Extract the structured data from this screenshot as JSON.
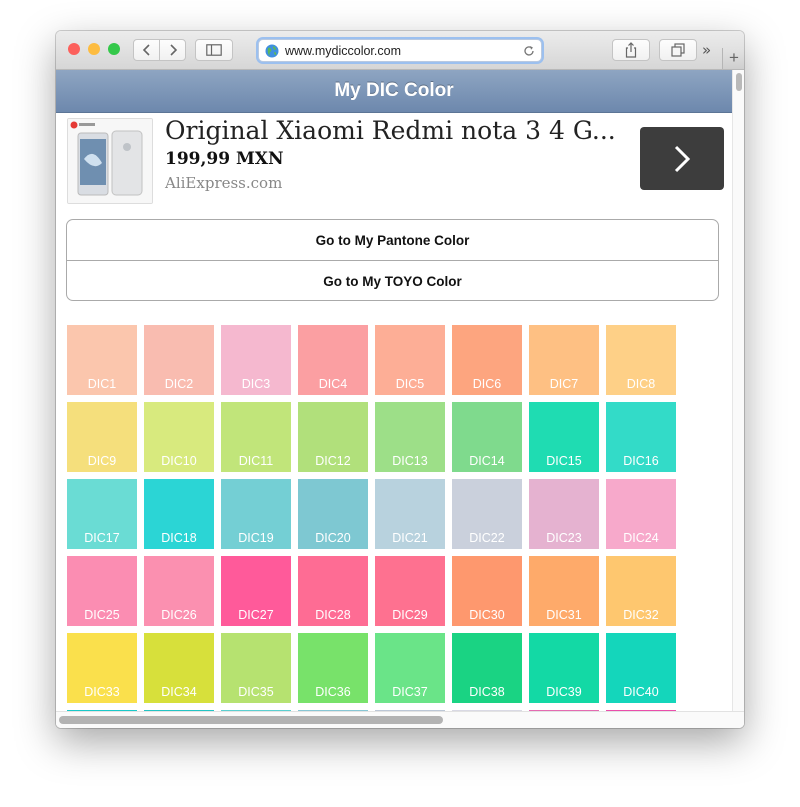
{
  "browser": {
    "url": "www.mydiccolor.com",
    "traffic_lights": [
      "#fc605c",
      "#fdbc40",
      "#34c84a"
    ]
  },
  "site": {
    "title": "My DIC Color"
  },
  "ad": {
    "title": "Original Xiaomi Redmi nota 3 4 G...",
    "price": "199,99 MXN",
    "source": "AliExpress.com"
  },
  "links": [
    "Go to My Pantone Color",
    "Go to My TOYO Color"
  ],
  "swatches": [
    {
      "label": "DIC1",
      "color": "#fbc6ad"
    },
    {
      "label": "DIC2",
      "color": "#f9bcb0"
    },
    {
      "label": "DIC3",
      "color": "#f5b8cf"
    },
    {
      "label": "DIC4",
      "color": "#fb9fa2"
    },
    {
      "label": "DIC5",
      "color": "#fdae96"
    },
    {
      "label": "DIC6",
      "color": "#fda57f"
    },
    {
      "label": "DIC7",
      "color": "#fec083"
    },
    {
      "label": "DIC8",
      "color": "#fed087"
    },
    {
      "label": "DIC9",
      "color": "#f5df7c"
    },
    {
      "label": "DIC10",
      "color": "#d8ea7e"
    },
    {
      "label": "DIC11",
      "color": "#c1e57a"
    },
    {
      "label": "DIC12",
      "color": "#b1e07b"
    },
    {
      "label": "DIC13",
      "color": "#9ddf88"
    },
    {
      "label": "DIC14",
      "color": "#7fda8d"
    },
    {
      "label": "DIC15",
      "color": "#1fdcb2"
    },
    {
      "label": "DIC16",
      "color": "#33dbc8"
    },
    {
      "label": "DIC17",
      "color": "#6adcd4"
    },
    {
      "label": "DIC18",
      "color": "#2bd5d5"
    },
    {
      "label": "DIC19",
      "color": "#74cfd4"
    },
    {
      "label": "DIC20",
      "color": "#7ec8d2"
    },
    {
      "label": "DIC21",
      "color": "#b8d2de"
    },
    {
      "label": "DIC22",
      "color": "#cad0dc"
    },
    {
      "label": "DIC23",
      "color": "#e5b2d0"
    },
    {
      "label": "DIC24",
      "color": "#f7a9cb"
    },
    {
      "label": "DIC25",
      "color": "#fb8db2"
    },
    {
      "label": "DIC26",
      "color": "#fb90b0"
    },
    {
      "label": "DIC27",
      "color": "#ff5a9a"
    },
    {
      "label": "DIC28",
      "color": "#fe6c94"
    },
    {
      "label": "DIC29",
      "color": "#fe7190"
    },
    {
      "label": "DIC30",
      "color": "#fe986e"
    },
    {
      "label": "DIC31",
      "color": "#feaa6a"
    },
    {
      "label": "DIC32",
      "color": "#fec76f"
    },
    {
      "label": "DIC33",
      "color": "#fae04c"
    },
    {
      "label": "DIC34",
      "color": "#d7e03b"
    },
    {
      "label": "DIC35",
      "color": "#b6e270"
    },
    {
      "label": "DIC36",
      "color": "#78e26a"
    },
    {
      "label": "DIC37",
      "color": "#6ae488"
    },
    {
      "label": "DIC38",
      "color": "#1ad383"
    },
    {
      "label": "DIC39",
      "color": "#13d9a5"
    },
    {
      "label": "DIC40",
      "color": "#14d6bb"
    }
  ],
  "swatch_partial_row": [
    "#19c9c9",
    "#22c4c4",
    "#5bcfd0",
    "#87c6d4",
    "#bcc7d6",
    "#d9d9e4",
    "#e46ab1",
    "#ea4dab"
  ]
}
